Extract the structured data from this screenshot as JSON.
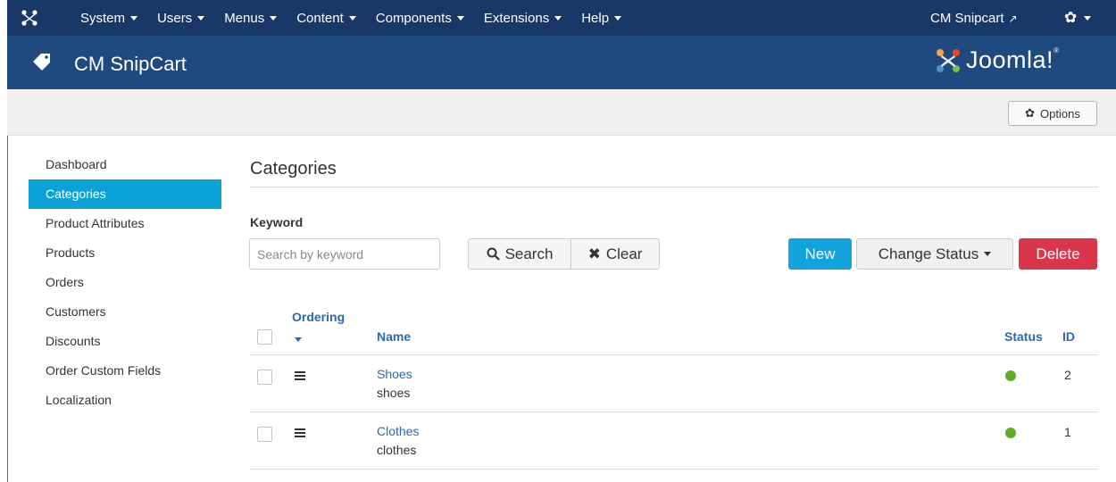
{
  "topnav": {
    "menu": [
      "System",
      "Users",
      "Menus",
      "Content",
      "Components",
      "Extensions",
      "Help"
    ],
    "site_link": "CM Snipcart",
    "site_link_icon": "external-link-icon",
    "settings_icon": "gear-icon",
    "logo_icon": "joomla-icon"
  },
  "header": {
    "title": "CM SnipCart",
    "title_icon": "tag-icon",
    "brand": "Joomla!",
    "brand_word": "Joomla",
    "brand_mark": "!",
    "brand_reg": "®"
  },
  "toolbar": {
    "options_label": "Options",
    "options_icon": "gear-icon"
  },
  "sidebar": {
    "items": [
      {
        "label": "Dashboard",
        "active": false
      },
      {
        "label": "Categories",
        "active": true
      },
      {
        "label": "Product Attributes",
        "active": false
      },
      {
        "label": "Products",
        "active": false
      },
      {
        "label": "Orders",
        "active": false
      },
      {
        "label": "Customers",
        "active": false
      },
      {
        "label": "Discounts",
        "active": false
      },
      {
        "label": "Order Custom Fields",
        "active": false
      },
      {
        "label": "Localization",
        "active": false
      }
    ]
  },
  "main": {
    "title": "Categories",
    "filter": {
      "keyword_label": "Keyword",
      "search_placeholder": "Search by keyword",
      "search_value": "",
      "search_button": "Search",
      "search_icon": "search-icon",
      "clear_button": "Clear",
      "clear_icon": "close-icon"
    },
    "actions": {
      "new": "New",
      "change_status": "Change Status",
      "delete": "Delete"
    },
    "table": {
      "columns": {
        "ordering": "Ordering",
        "name": "Name",
        "status": "Status",
        "id": "ID"
      },
      "rows": [
        {
          "name": "Shoes",
          "alias": "shoes",
          "status": "published",
          "id": "2"
        },
        {
          "name": "Clothes",
          "alias": "clothes",
          "status": "published",
          "id": "1"
        }
      ]
    }
  },
  "colors": {
    "topnav_bg": "#1a3867",
    "header_bg": "#1f4a7f",
    "active_item": "#0aa3d8",
    "new_button": "#12a3dc",
    "delete_button": "#d9354b",
    "link": "#2a69b8",
    "published": "#5cae29"
  }
}
